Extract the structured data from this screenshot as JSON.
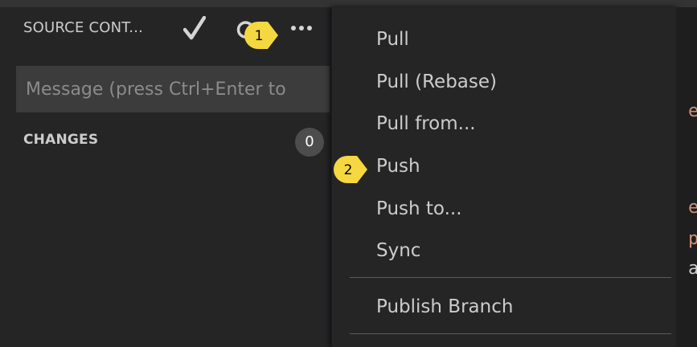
{
  "scm": {
    "title": "SOURCE CONT...",
    "message_placeholder": "Message (press Ctrl+Enter to",
    "changes_label": "CHANGES",
    "changes_count": "0"
  },
  "menu": {
    "items": [
      "Pull",
      "Pull (Rebase)",
      "Pull from...",
      "Push",
      "Push to...",
      "Sync",
      "Publish Branch"
    ]
  },
  "callouts": [
    "1",
    "2"
  ],
  "editor_glimpse": [
    "e",
    "e",
    "p",
    "a"
  ],
  "colors": {
    "background": "#252526",
    "input_background": "#3c3c3c",
    "text": "#cccccc",
    "callout": "#f5d740",
    "editor_token": "#ce9178"
  },
  "icons": {
    "commit": "checkmark-icon",
    "refresh": "refresh-icon",
    "more": "more-icon"
  }
}
